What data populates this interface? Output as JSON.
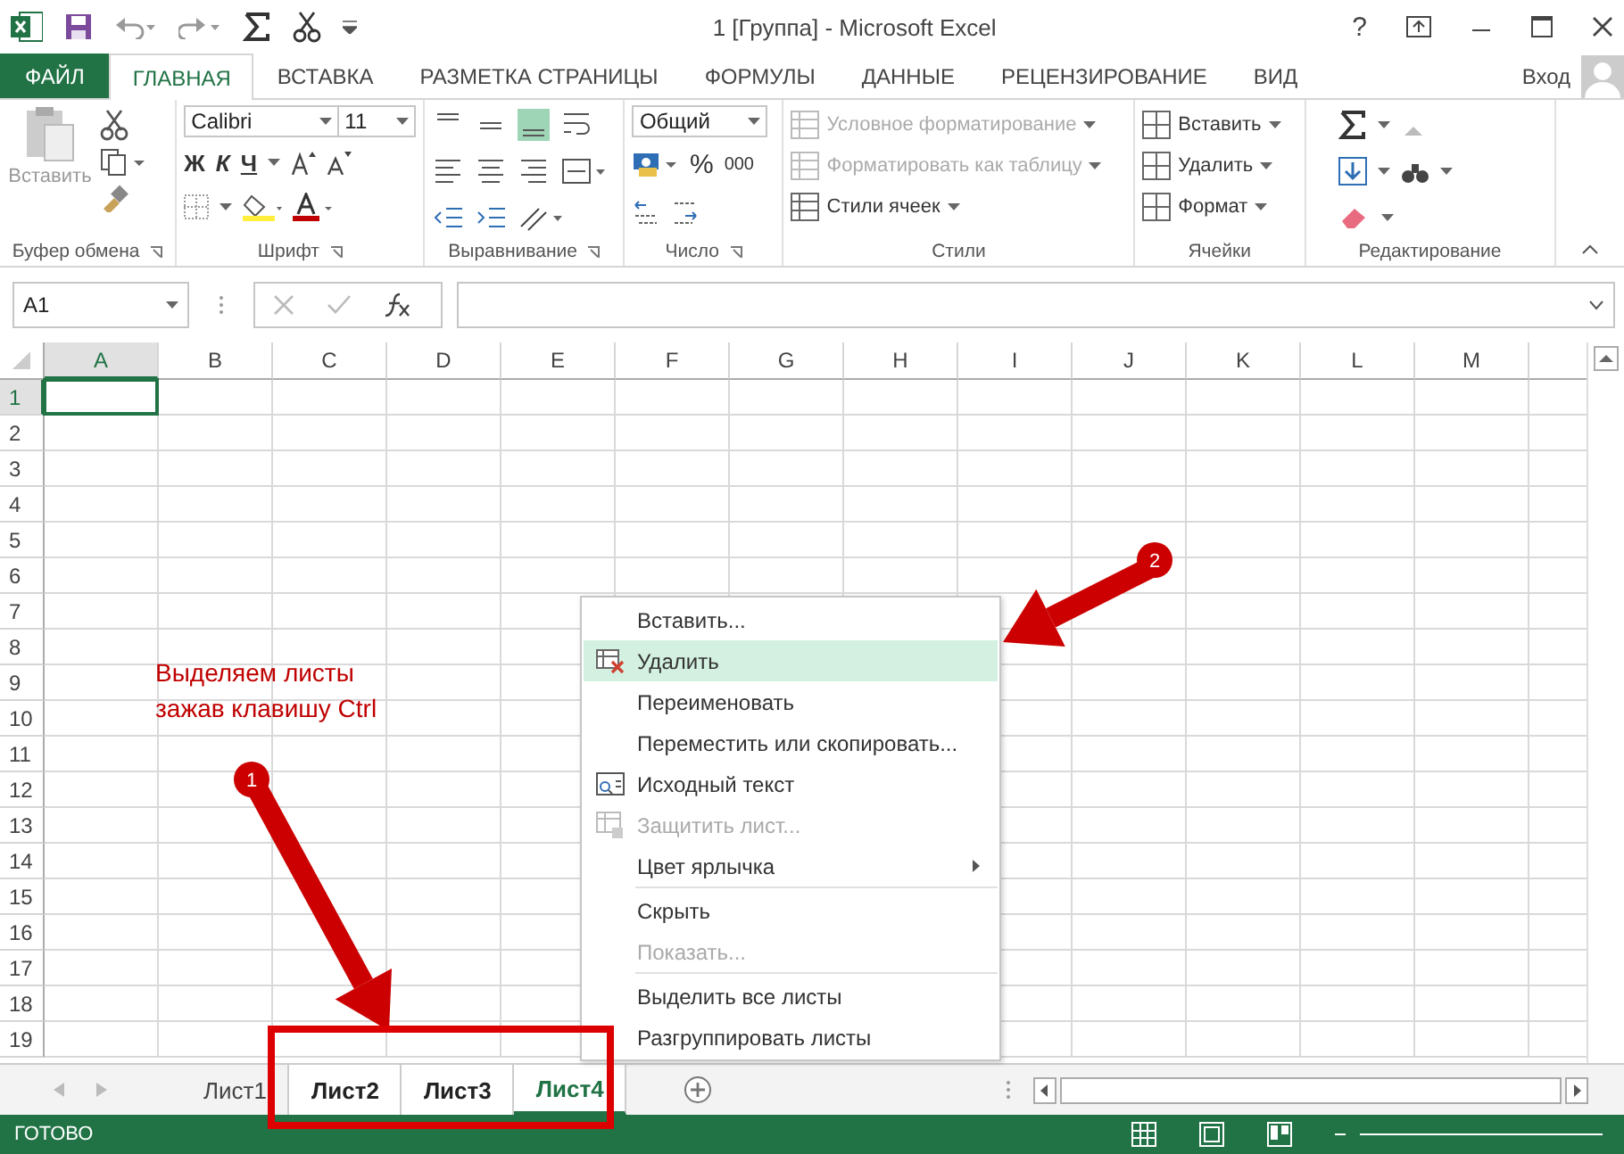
{
  "window": {
    "title": "1  [Группа] - Microsoft Excel",
    "help": "?"
  },
  "ribbon_tabs": [
    {
      "label": "ФАЙЛ",
      "kind": "file",
      "selected": false
    },
    {
      "label": "ГЛАВНАЯ",
      "kind": "tab",
      "selected": true
    },
    {
      "label": "ВСТАВКА",
      "kind": "tab",
      "selected": false
    },
    {
      "label": "РАЗМЕТКА СТРАНИЦЫ",
      "kind": "tab",
      "selected": false
    },
    {
      "label": "ФОРМУЛЫ",
      "kind": "tab",
      "selected": false
    },
    {
      "label": "ДАННЫЕ",
      "kind": "tab",
      "selected": false
    },
    {
      "label": "РЕЦЕНЗИРОВАНИЕ",
      "kind": "tab",
      "selected": false
    },
    {
      "label": "ВИД",
      "kind": "tab",
      "selected": false
    }
  ],
  "user": "Вход",
  "ribbon": {
    "clipboard": {
      "paste": "Вставить",
      "label": "Буфер обмена"
    },
    "font": {
      "name": "Calibri",
      "size": "11",
      "bold": "Ж",
      "italic": "К",
      "underline": "Ч",
      "label": "Шрифт"
    },
    "alignment": {
      "label": "Выравнивание"
    },
    "number": {
      "format": "Общий",
      "percent": "%",
      "thousands": "000",
      "label": "Число"
    },
    "styles": {
      "items": [
        {
          "label": "Условное форматирование",
          "disabled": true
        },
        {
          "label": "Форматировать как таблицу",
          "disabled": true
        },
        {
          "label": "Стили ячеек",
          "disabled": false
        }
      ],
      "label": "Стили"
    },
    "cells": {
      "items": [
        "Вставить",
        "Удалить",
        "Формат"
      ],
      "label": "Ячейки"
    },
    "editing": {
      "label": "Редактирование"
    }
  },
  "formula_bar": {
    "name_box": "A1"
  },
  "grid": {
    "columns": [
      {
        "label": "A",
        "selected": true
      },
      {
        "label": "B",
        "selected": false
      },
      {
        "label": "C",
        "selected": false
      },
      {
        "label": "D",
        "selected": false
      },
      {
        "label": "E",
        "selected": false
      },
      {
        "label": "F",
        "selected": false
      },
      {
        "label": "G",
        "selected": false
      },
      {
        "label": "H",
        "selected": false
      },
      {
        "label": "I",
        "selected": false
      },
      {
        "label": "J",
        "selected": false
      },
      {
        "label": "K",
        "selected": false
      },
      {
        "label": "L",
        "selected": false
      },
      {
        "label": "M",
        "selected": false
      }
    ],
    "rows": [
      {
        "label": "1",
        "selected": true
      },
      {
        "label": "2",
        "selected": false
      },
      {
        "label": "3",
        "selected": false
      },
      {
        "label": "4",
        "selected": false
      },
      {
        "label": "5",
        "selected": false
      },
      {
        "label": "6",
        "selected": false
      },
      {
        "label": "7",
        "selected": false
      },
      {
        "label": "8",
        "selected": false
      },
      {
        "label": "9",
        "selected": false
      },
      {
        "label": "10",
        "selected": false
      },
      {
        "label": "11",
        "selected": false
      },
      {
        "label": "12",
        "selected": false
      },
      {
        "label": "13",
        "selected": false
      },
      {
        "label": "14",
        "selected": false
      },
      {
        "label": "15",
        "selected": false
      },
      {
        "label": "16",
        "selected": false
      },
      {
        "label": "17",
        "selected": false
      },
      {
        "label": "18",
        "selected": false
      },
      {
        "label": "19",
        "selected": false
      }
    ]
  },
  "context_menu": [
    {
      "label": "Вставить...",
      "kind": "plain",
      "disabled": false,
      "selected": false,
      "submenu": false,
      "separator_before": false
    },
    {
      "label": "Удалить",
      "kind": "delete",
      "disabled": false,
      "selected": true,
      "submenu": false,
      "separator_before": false
    },
    {
      "label": "Переименовать",
      "kind": "plain",
      "disabled": false,
      "selected": false,
      "submenu": false,
      "separator_before": false
    },
    {
      "label": "Переместить или скопировать...",
      "kind": "plain",
      "disabled": false,
      "selected": false,
      "submenu": false,
      "separator_before": false
    },
    {
      "label": "Исходный текст",
      "kind": "source",
      "disabled": false,
      "selected": false,
      "submenu": false,
      "separator_before": false
    },
    {
      "label": "Защитить лист...",
      "kind": "protect",
      "disabled": true,
      "selected": false,
      "submenu": false,
      "separator_before": false
    },
    {
      "label": "Цвет ярлычка",
      "kind": "plain",
      "disabled": false,
      "selected": false,
      "submenu": true,
      "separator_before": false
    },
    {
      "label": "Скрыть",
      "kind": "plain",
      "disabled": false,
      "selected": false,
      "submenu": false,
      "separator_before": true
    },
    {
      "label": "Показать...",
      "kind": "plain",
      "disabled": true,
      "selected": false,
      "submenu": false,
      "separator_before": false
    },
    {
      "label": "Выделить все листы",
      "kind": "plain",
      "disabled": false,
      "selected": false,
      "submenu": false,
      "separator_before": true
    },
    {
      "label": "Разгруппировать листы",
      "kind": "plain",
      "disabled": false,
      "selected": false,
      "submenu": false,
      "separator_before": false
    }
  ],
  "sheet_tabs": [
    {
      "label": "Лист1",
      "selected": false,
      "active": false
    },
    {
      "label": "Лист2",
      "selected": true,
      "active": false
    },
    {
      "label": "Лист3",
      "selected": true,
      "active": false
    },
    {
      "label": "Лист4",
      "selected": true,
      "active": true
    }
  ],
  "status_bar": {
    "text": "ГОТОВО"
  },
  "annotations": {
    "note": "Выделяем листы зажав клавишу Ctrl",
    "markers": [
      {
        "label": "1"
      },
      {
        "label": "2"
      }
    ]
  }
}
